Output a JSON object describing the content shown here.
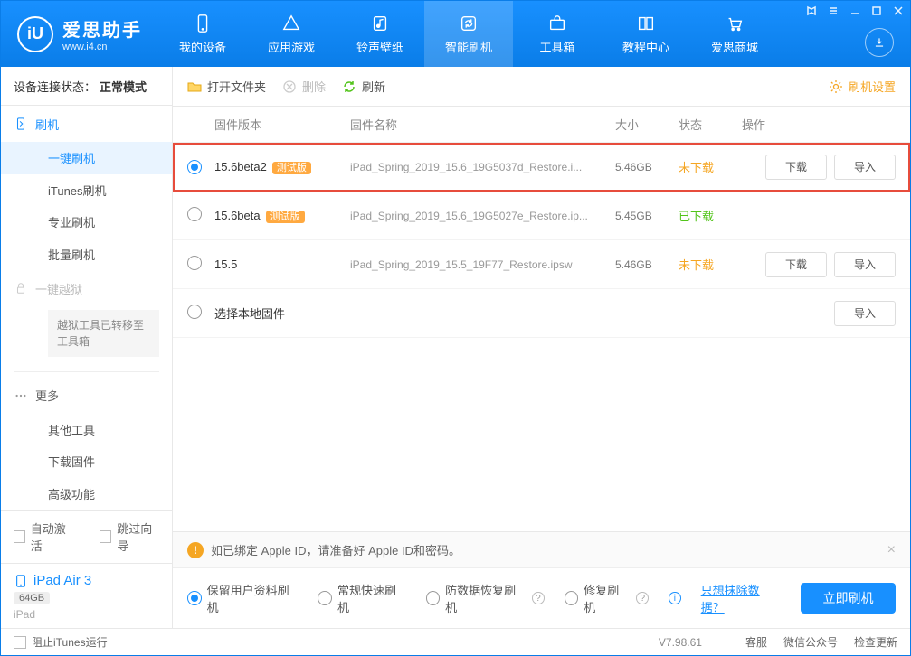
{
  "app": {
    "name": "爱思助手",
    "domain": "www.i4.cn"
  },
  "nav": {
    "items": [
      {
        "label": "我的设备"
      },
      {
        "label": "应用游戏"
      },
      {
        "label": "铃声壁纸"
      },
      {
        "label": "智能刷机"
      },
      {
        "label": "工具箱"
      },
      {
        "label": "教程中心"
      },
      {
        "label": "爱思商城"
      }
    ]
  },
  "sidebar": {
    "conn_label": "设备连接状态：",
    "conn_value": "正常模式",
    "group_flash": "刷机",
    "items_flash": [
      "一键刷机",
      "iTunes刷机",
      "专业刷机",
      "批量刷机"
    ],
    "group_jb": "一键越狱",
    "jb_note": "越狱工具已转移至工具箱",
    "group_more": "更多",
    "items_more": [
      "其他工具",
      "下载固件",
      "高级功能"
    ],
    "auto_activate": "自动激活",
    "skip_guide": "跳过向导",
    "device_name": "iPad Air 3",
    "device_storage": "64GB",
    "device_type": "iPad"
  },
  "toolbar": {
    "open": "打开文件夹",
    "delete": "删除",
    "refresh": "刷新",
    "settings": "刷机设置"
  },
  "table": {
    "headers": {
      "version": "固件版本",
      "name": "固件名称",
      "size": "大小",
      "status": "状态",
      "actions": "操作"
    },
    "rows": [
      {
        "selected": true,
        "version": "15.6beta2",
        "beta": "测试版",
        "name": "iPad_Spring_2019_15.6_19G5037d_Restore.i...",
        "size": "5.46GB",
        "status": "未下载",
        "status_class": "st-nodl",
        "dl": "下载",
        "imp": "导入",
        "hl": true
      },
      {
        "selected": false,
        "version": "15.6beta",
        "beta": "测试版",
        "name": "iPad_Spring_2019_15.6_19G5027e_Restore.ip...",
        "size": "5.45GB",
        "status": "已下载",
        "status_class": "st-dl"
      },
      {
        "selected": false,
        "version": "15.5",
        "beta": "",
        "name": "iPad_Spring_2019_15.5_19F77_Restore.ipsw",
        "size": "5.46GB",
        "status": "未下载",
        "status_class": "st-nodl",
        "dl": "下载",
        "imp": "导入"
      },
      {
        "selected": false,
        "version": "选择本地固件",
        "beta": "",
        "name": "",
        "size": "",
        "status": "",
        "status_class": "",
        "imp": "导入"
      }
    ]
  },
  "notice": {
    "text": "如已绑定 Apple ID，请准备好 Apple ID和密码。"
  },
  "flash": {
    "opts": [
      "保留用户资料刷机",
      "常规快速刷机",
      "防数据恢复刷机",
      "修复刷机"
    ],
    "erase_link": "只想抹除数据？",
    "go": "立即刷机"
  },
  "statusbar": {
    "block_itunes": "阻止iTunes运行",
    "version": "V7.98.61",
    "links": [
      "客服",
      "微信公众号",
      "检查更新"
    ]
  }
}
